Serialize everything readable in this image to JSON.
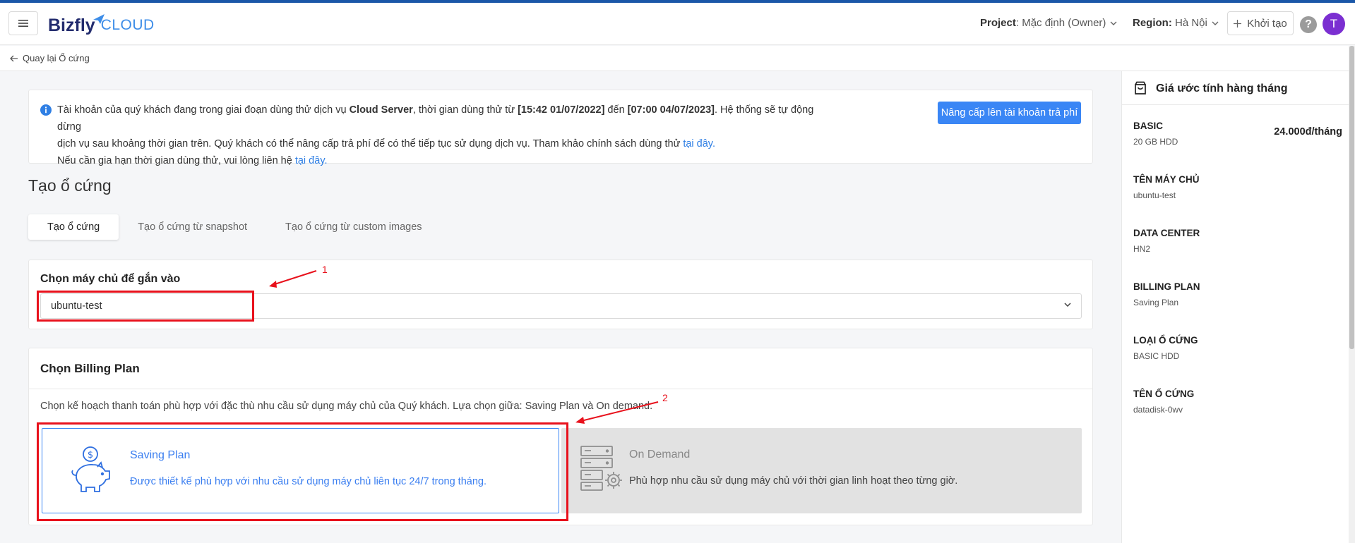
{
  "header": {
    "logo_brand": "Bizfly",
    "logo_cloud": "CLOUD",
    "project_label": "Project",
    "project_value": ": Mặc định (Owner)",
    "region_label": "Region:",
    "region_value": "Hà Nội",
    "create_label": "Khởi tạo",
    "help_label": "?",
    "avatar_letter": "T"
  },
  "breadcrumb": {
    "back_label": "Quay lại Ổ cứng"
  },
  "notice": {
    "line1_a": "Tài khoản của quý khách đang trong giai đoạn dùng thử dịch vụ ",
    "line1_service": "Cloud Server",
    "line1_b": ", thời gian dùng thử từ ",
    "line1_from": "[15:42 01/07/2022]",
    "line1_c": " đến ",
    "line1_to": "[07:00 04/07/2023]",
    "line1_d": ". Hệ thống sẽ tự động dừng",
    "line2_a": "dịch vụ sau khoảng thời gian trên. Quý khách có thể nâng cấp trả phí để có thể tiếp tục sử dụng dịch vụ. Tham khảo chính sách dùng thử ",
    "line2_link": "tại đây.",
    "line3_a": "Nếu cần gia hạn thời gian dùng thử, vui lòng liên hệ ",
    "line3_link": "tại đây.",
    "upgrade_label": "Nâng cấp lên tài khoản trả phí"
  },
  "page": {
    "title": "Tạo ổ cứng"
  },
  "tabs": [
    {
      "label": "Tạo ổ cứng",
      "active": true
    },
    {
      "label": "Tạo ổ cứng từ snapshot",
      "active": false
    },
    {
      "label": "Tạo ổ cứng từ custom images",
      "active": false
    }
  ],
  "server_select": {
    "label": "Chọn máy chủ để gắn vào",
    "value": "ubuntu-test"
  },
  "billing": {
    "title": "Chọn Billing Plan",
    "description": "Chọn kế hoạch thanh toán phù hợp với đặc thù nhu cầu sử dụng máy chủ của Quý khách. Lựa chọn giữa: Saving Plan và On demand.",
    "plans": [
      {
        "title": "Saving Plan",
        "desc": "Được thiết kế phù hợp với nhu cầu sử dụng máy chủ liên tục 24/7 trong tháng.",
        "icon": "piggy-bank-icon",
        "selected": true
      },
      {
        "title": "On Demand",
        "desc": "Phù hợp nhu cầu sử dụng máy chủ với thời gian linh hoạt theo từng giờ.",
        "icon": "server-gear-icon",
        "selected": false
      }
    ]
  },
  "annotations": {
    "n1": "1",
    "n2": "2",
    "color": "#e8111c"
  },
  "summary": {
    "title": "Giá ước tính hàng tháng",
    "items": [
      {
        "key": "BASIC",
        "value": "20 GB HDD",
        "price": "24.000đ/tháng"
      },
      {
        "key": "TÊN MÁY CHỦ",
        "value": "ubuntu-test"
      },
      {
        "key": "DATA CENTER",
        "value": "HN2"
      },
      {
        "key": "BILLING PLAN",
        "value": "Saving Plan"
      },
      {
        "key": "LOẠI Ổ CỨNG",
        "value": "BASIC HDD"
      },
      {
        "key": "TÊN Ổ CỨNG",
        "value": "datadisk-0wv"
      }
    ]
  },
  "colors": {
    "primary": "#3a86f5",
    "brand_dark": "#232c6e",
    "avatar": "#7b2fd1"
  }
}
